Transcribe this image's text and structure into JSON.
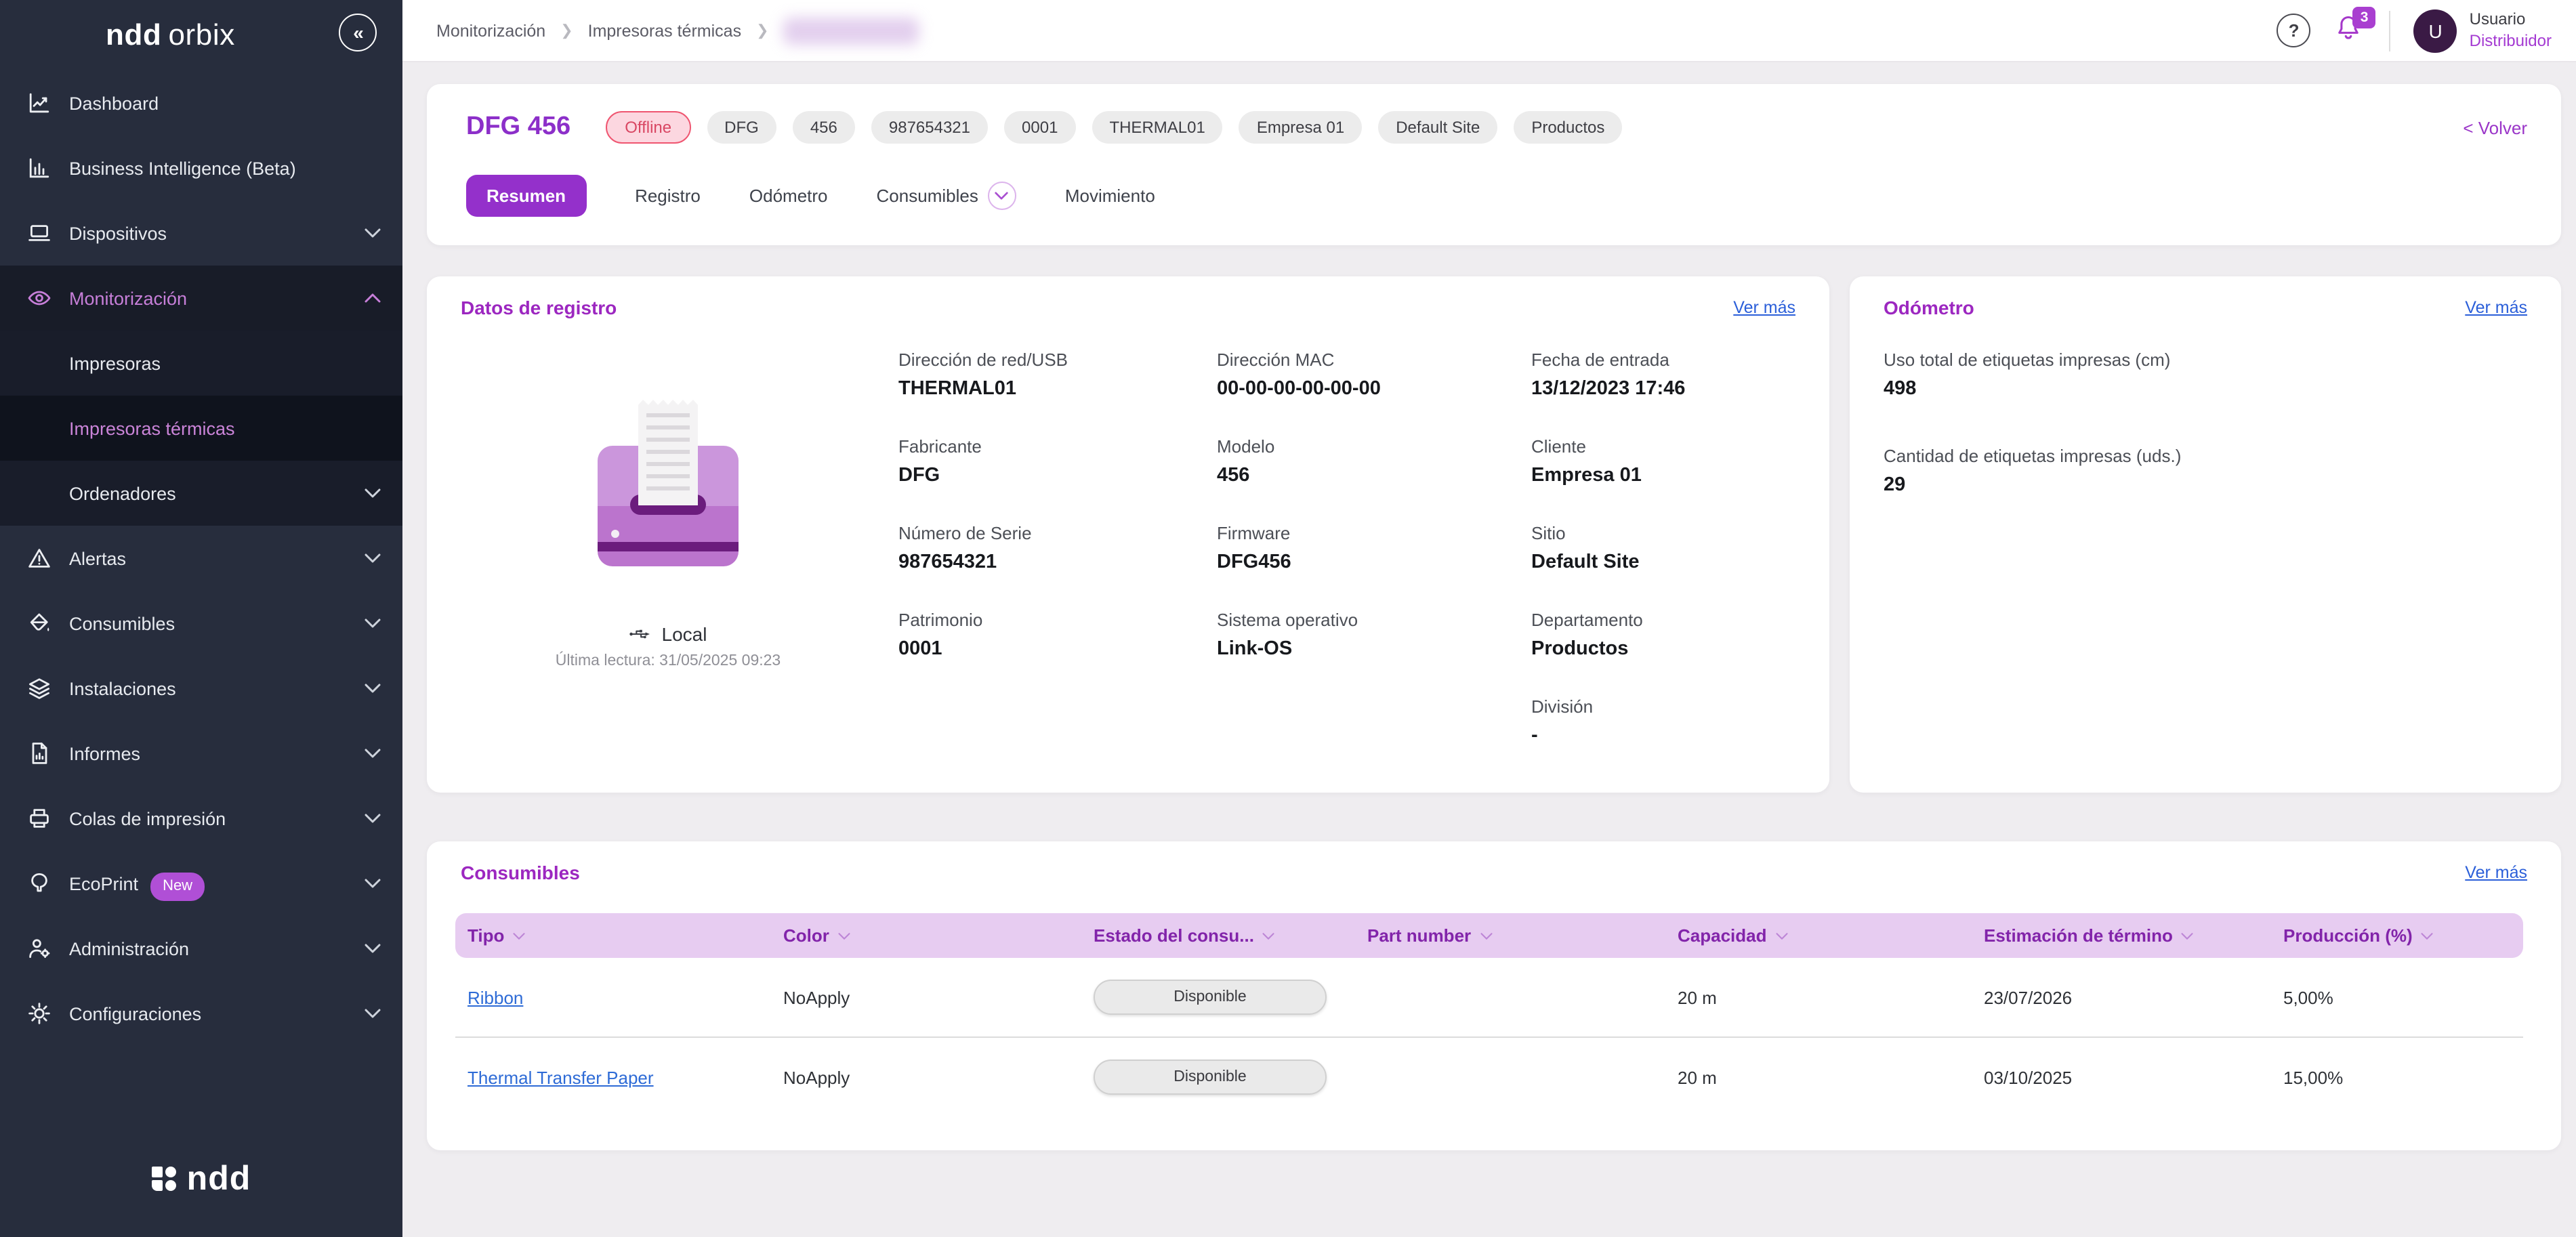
{
  "sidebar": {
    "brand_bold": "ndd",
    "brand_light": "orbix",
    "collapse_glyph": "«",
    "items": [
      {
        "label": "Dashboard"
      },
      {
        "label": "Business Intelligence (Beta)"
      },
      {
        "label": "Dispositivos"
      },
      {
        "label": "Monitorización",
        "active": true
      },
      {
        "label": "Impresoras"
      },
      {
        "label": "Impresoras térmicas",
        "selected": true
      },
      {
        "label": "Ordenadores"
      },
      {
        "label": "Alertas"
      },
      {
        "label": "Consumibles"
      },
      {
        "label": "Instalaciones"
      },
      {
        "label": "Informes"
      },
      {
        "label": "Colas de impresión"
      },
      {
        "label": "EcoPrint",
        "badge": "New"
      },
      {
        "label": "Administración"
      },
      {
        "label": "Configuraciones"
      }
    ],
    "footer_logo": "ndd"
  },
  "topbar": {
    "breadcrumb": [
      "Monitorización",
      "Impresoras térmicas"
    ],
    "breadcrumb_redacted": true,
    "help_glyph": "?",
    "notification_count": "3",
    "avatar_initial": "U",
    "user_name": "Usuario",
    "user_role": "Distribuidor"
  },
  "header": {
    "title": "DFG 456",
    "status": "Offline",
    "tags": [
      "DFG",
      "456",
      "987654321",
      "0001",
      "THERMAL01",
      "Empresa 01",
      "Default Site",
      "Productos"
    ],
    "back_label": "< Volver",
    "tabs": [
      "Resumen",
      "Registro",
      "Odómetro",
      "Consumibles",
      "Movimiento"
    ]
  },
  "registro": {
    "title": "Datos de registro",
    "link": "Ver más",
    "connection": "Local",
    "last_reading": "Última lectura: 31/05/2025 09:23",
    "fields": [
      {
        "label": "Dirección de red/USB",
        "value": "THERMAL01"
      },
      {
        "label": "Dirección MAC",
        "value": "00-00-00-00-00-00"
      },
      {
        "label": "Fecha de entrada",
        "value": "13/12/2023 17:46"
      },
      {
        "label": "Fabricante",
        "value": "DFG"
      },
      {
        "label": "Modelo",
        "value": "456"
      },
      {
        "label": "Cliente",
        "value": "Empresa 01"
      },
      {
        "label": "Número de Serie",
        "value": "987654321"
      },
      {
        "label": "Firmware",
        "value": "DFG456"
      },
      {
        "label": "Sitio",
        "value": "Default Site"
      },
      {
        "label": "Patrimonio",
        "value": "0001"
      },
      {
        "label": "Sistema operativo",
        "value": "Link-OS"
      },
      {
        "label": "Departamento",
        "value": "Productos"
      },
      {
        "label": "División",
        "value": "-"
      }
    ]
  },
  "odometro": {
    "title": "Odómetro",
    "link": "Ver más",
    "fields": [
      {
        "label": "Uso total de etiquetas impresas (cm)",
        "value": "498"
      },
      {
        "label": "Cantidad de etiquetas impresas (uds.)",
        "value": "29"
      }
    ]
  },
  "consumibles": {
    "title": "Consumibles",
    "link": "Ver más",
    "columns": [
      "Tipo",
      "Color",
      "Estado del consu...",
      "Part number",
      "Capacidad",
      "Estimación de término",
      "Producción (%)"
    ],
    "rows": [
      {
        "type": "Ribbon",
        "color": "NoApply",
        "status": "Disponible",
        "part_number": "",
        "capacity": "20 m",
        "end_estimate": "23/07/2026",
        "production": "5,00%"
      },
      {
        "type": "Thermal Transfer Paper",
        "color": "NoApply",
        "status": "Disponible",
        "part_number": "",
        "capacity": "20 m",
        "end_estimate": "03/10/2025",
        "production": "15,00%"
      }
    ]
  },
  "colors": {
    "sidebar_bg": "#272d3d",
    "sidebar_active_bg": "#181c28",
    "sidebar_selected_bg": "#0f131d",
    "accent_purple": "#9430cb",
    "title_purple": "#8c2fc9",
    "card_title_purple": "#9c27c0",
    "link_blue": "#2b5fd9",
    "offline_text": "#d94763",
    "offline_bg": "#fcd7e0",
    "table_header_bg": "#e7ccf1",
    "badge_purple": "#b04fd6",
    "main_bg": "#efedf0"
  }
}
